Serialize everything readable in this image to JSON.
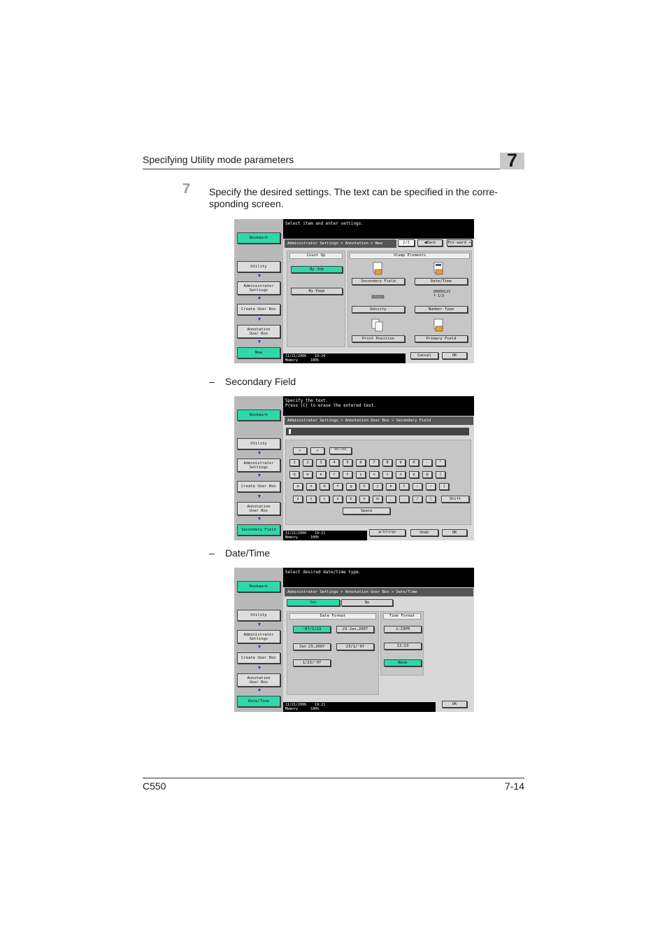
{
  "header": {
    "title": "Specifying Utility mode parameters",
    "chapter": "7"
  },
  "step": {
    "number": "7",
    "text": "Specify the desired settings. The text can be specified in the corre-sponding screen."
  },
  "captions": {
    "secondary": "Secondary Field",
    "datetime": "Date/Time",
    "dash": "–"
  },
  "footer": {
    "model": "C550",
    "page": "7-14"
  },
  "screen1": {
    "message": "Select item and enter settings.",
    "breadcrumb": "Administrator Settings > Annotation > New",
    "page_indicator": "2/3",
    "back": "Back",
    "forward": "For-ward",
    "side": {
      "bookmark": "Bookmark",
      "utility": "Utility",
      "admin": "Administrator\nSettings",
      "create": "Create User Box",
      "annot": "Annotation\nUser Box",
      "current": "New"
    },
    "count_up": {
      "header": "Count Up",
      "by_job": "By Job",
      "by_page": "By Page"
    },
    "stamp": {
      "header": "Stamp Elements",
      "secondary": "Secondary Field",
      "datetime": "Date/Time",
      "density": "Density",
      "number_type": "Number Type",
      "print_position": "Print Position",
      "primary": "Primary Field",
      "number_sample": "00000123",
      "number_sample2": "1/3"
    },
    "status": {
      "date": "11/21/2006",
      "time": "19:20",
      "memory_label": "Memory",
      "memory": "100%"
    },
    "cancel": "Cancel",
    "ok": "OK"
  },
  "screen2": {
    "message": "Specify the text.\nPress [C] to erase the entered text.",
    "breadcrumb": "Administrator Settings > Annotation User Box > Secondary Field",
    "side": {
      "bookmark": "Bookmark",
      "utility": "Utility",
      "admin": "Administrator\nSettings",
      "create": "Create User Box",
      "annot": "Annotation\nUser Box",
      "current": "Secondary Field"
    },
    "left_arrow": "←",
    "right_arrow": "→",
    "delete": "Del-ete",
    "row1": [
      "1",
      "2",
      "3",
      "4",
      "5",
      "6",
      "7",
      "8",
      "9",
      "0",
      "-",
      "^"
    ],
    "row2": [
      "q",
      "w",
      "e",
      "r",
      "t",
      "y",
      "u",
      "i",
      "o",
      "p",
      "@",
      "["
    ],
    "row3": [
      "a",
      "s",
      "d",
      "f",
      "g",
      "h",
      "j",
      "k",
      "l",
      ";",
      ":",
      "]"
    ],
    "row4": [
      "z",
      "x",
      "c",
      "v",
      "b",
      "n",
      "m",
      ",",
      ".",
      "/",
      "\\"
    ],
    "shift": "Shift",
    "space": "Space",
    "enlarge": "Enlarge",
    "undo": "Undo",
    "ok": "OK",
    "status": {
      "date": "11/21/2006",
      "time": "19:21",
      "memory_label": "Memory",
      "memory": "100%"
    }
  },
  "screen3": {
    "message": "Select desired date/time type.",
    "breadcrumb": "Administrator Settings > Annotation User Box > Date/Time",
    "side": {
      "bookmark": "Bookmark",
      "utility": "Utility",
      "admin": "Administrator\nSettings",
      "create": "Create User Box",
      "annot": "Annotation\nUser Box",
      "current": "Date/Time"
    },
    "yes": "Yes",
    "no": "No",
    "date_format": {
      "header": "Date Format",
      "f1": "'07/1/23",
      "f2": "23 Jan,2007",
      "f3": "Jan 23,2007",
      "f4": "23/1/'07",
      "f5": "1/23/'07"
    },
    "time_format": {
      "header": "Time Format",
      "t1": "1:23PM",
      "t2": "13:23",
      "t3": "None"
    },
    "ok": "OK",
    "status": {
      "date": "11/21/2006",
      "time": "19:21",
      "memory_label": "Memory",
      "memory": "100%"
    }
  }
}
